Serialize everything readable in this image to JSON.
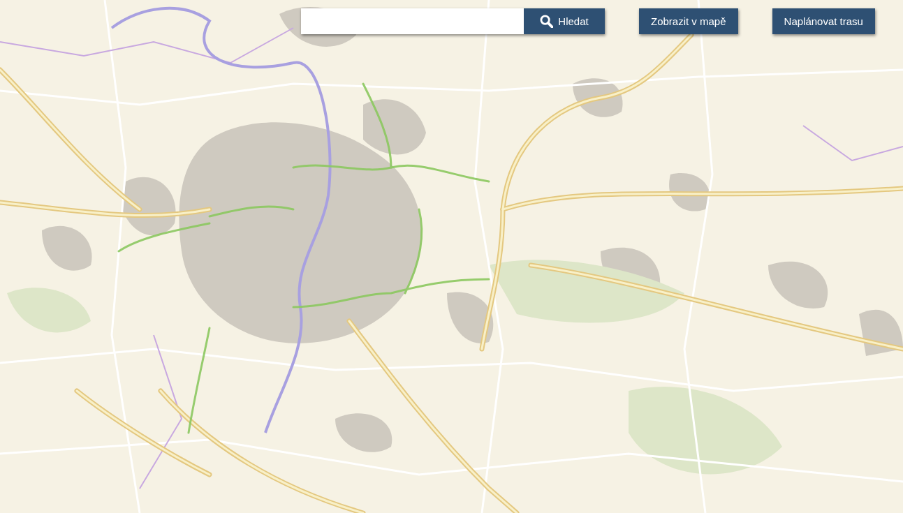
{
  "search": {
    "button": "Hledat"
  },
  "buttons": [
    {
      "label": "Zobrazit v mapě"
    },
    {
      "label": "Naplánovat trasu"
    }
  ]
}
